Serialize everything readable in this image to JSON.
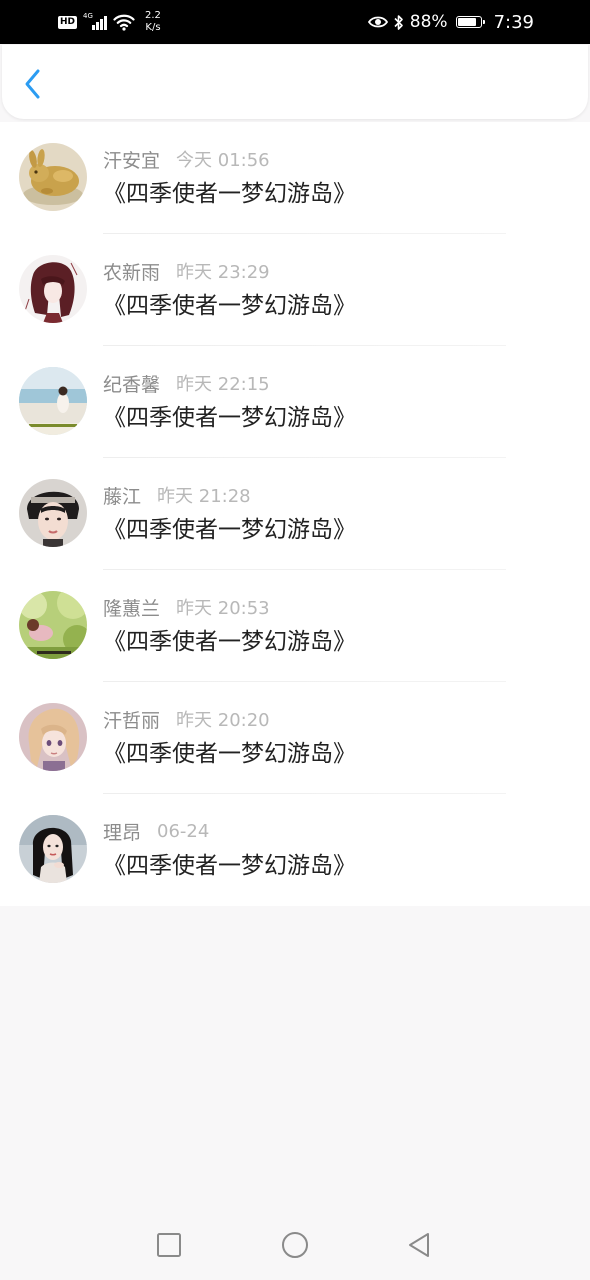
{
  "status_bar": {
    "hd": "HD",
    "network_type": "4G",
    "speed_value": "2.2",
    "speed_unit": "K/s",
    "battery": "88%",
    "battery_level": 0.88,
    "time": "7:39"
  },
  "header": {
    "back_icon": "chevron-left-icon",
    "accent_color": "#2b9cf2"
  },
  "messages": [
    {
      "name": "汗安宜",
      "time": "今天 01:56",
      "title": "《四季使者一梦幻游岛》",
      "avatar": "golden-rabbit-figurine"
    },
    {
      "name": "农新雨",
      "time": "昨天 23:29",
      "title": "《四季使者一梦幻游岛》",
      "avatar": "anime-girl-sketch"
    },
    {
      "name": "纪香馨",
      "time": "昨天 22:15",
      "title": "《四季使者一梦幻游岛》",
      "avatar": "girl-by-sea"
    },
    {
      "name": "藤江",
      "time": "昨天 21:28",
      "title": "《四季使者一梦幻游岛》",
      "avatar": "young-man-portrait"
    },
    {
      "name": "隆蕙兰",
      "time": "昨天 20:53",
      "title": "《四季使者一梦幻游岛》",
      "avatar": "girl-in-meadow"
    },
    {
      "name": "汗哲丽",
      "time": "昨天 20:20",
      "title": "《四季使者一梦幻游岛》",
      "avatar": "anime-blonde-girl"
    },
    {
      "name": "理昂",
      "time": "06-24",
      "title": "《四季使者一梦幻游岛》",
      "avatar": "woman-portrait"
    }
  ],
  "nav_bar": {
    "recents_icon": "square-icon",
    "home_icon": "circle-icon",
    "back_icon": "triangle-back-icon"
  }
}
